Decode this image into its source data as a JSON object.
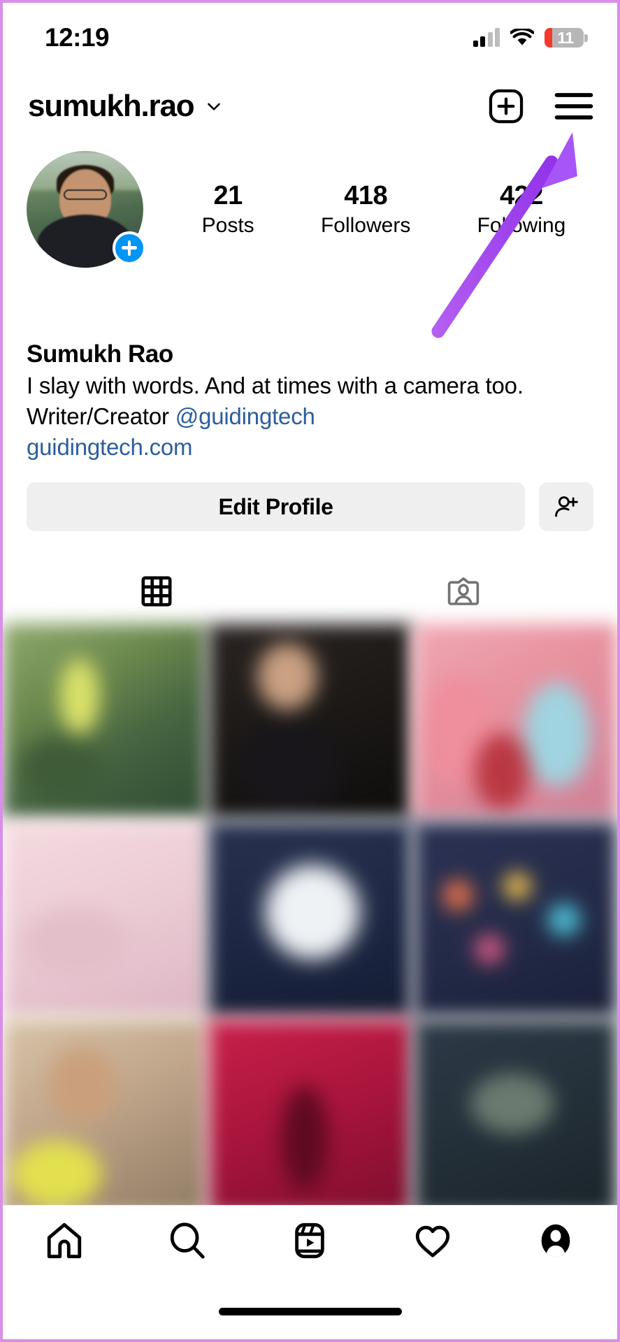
{
  "status_bar": {
    "time": "12:19",
    "battery_level": "11",
    "battery_low_color": "#f6382e",
    "cellular_icon": "cellular-signal-icon",
    "wifi_icon": "wifi-icon",
    "battery_icon": "battery-icon"
  },
  "header": {
    "username": "sumukh.rao",
    "chevron_icon": "chevron-down-icon",
    "create_icon": "create-post-icon",
    "menu_icon": "hamburger-menu-icon"
  },
  "profile": {
    "avatar_alt": "profile-avatar",
    "add_story_icon": "plus-icon",
    "display_name": "Sumukh Rao",
    "bio_line_1": "I slay with words. And at times with a camera too.",
    "bio_line_2_prefix": "Writer/Creator ",
    "bio_mention": "@guidingtech",
    "bio_url": "guidingtech.com",
    "link_color": "#2b5e9e",
    "stats": [
      {
        "value": "21",
        "label": "Posts"
      },
      {
        "value": "418",
        "label": "Followers"
      },
      {
        "value": "422",
        "label": "Following"
      }
    ]
  },
  "actions": {
    "edit_profile_label": "Edit Profile",
    "add_person_icon": "add-person-icon",
    "button_bg": "#efefef"
  },
  "tabs": [
    {
      "name": "grid-tab",
      "icon": "grid-icon",
      "active": true
    },
    {
      "name": "tagged-tab",
      "icon": "tagged-person-icon",
      "active": false
    }
  ],
  "grid_posts": [
    {
      "id": "post-1",
      "tone": "green-outdoor"
    },
    {
      "id": "post-2",
      "tone": "dark-portrait"
    },
    {
      "id": "post-3",
      "tone": "pink-group"
    },
    {
      "id": "post-4",
      "tone": "pale-pink"
    },
    {
      "id": "post-5",
      "tone": "navy-moon"
    },
    {
      "id": "post-6",
      "tone": "dark-blue-lights"
    },
    {
      "id": "post-7",
      "tone": "yellow-portrait"
    },
    {
      "id": "post-8",
      "tone": "crimson-red"
    },
    {
      "id": "post-9",
      "tone": "dark-teal"
    }
  ],
  "bottom_nav": [
    {
      "name": "nav-home",
      "icon": "home-icon",
      "active": false
    },
    {
      "name": "nav-search",
      "icon": "search-icon",
      "active": false
    },
    {
      "name": "nav-reels",
      "icon": "reels-icon",
      "active": false
    },
    {
      "name": "nav-activity",
      "icon": "heart-icon",
      "active": false
    },
    {
      "name": "nav-profile",
      "icon": "profile-avatar-icon",
      "active": true
    }
  ],
  "annotation": {
    "arrow_color": "#a855f7",
    "arrow_target": "hamburger-menu-icon"
  },
  "device": {
    "frame_color": "#d98fe8",
    "home_indicator": "home-indicator"
  }
}
